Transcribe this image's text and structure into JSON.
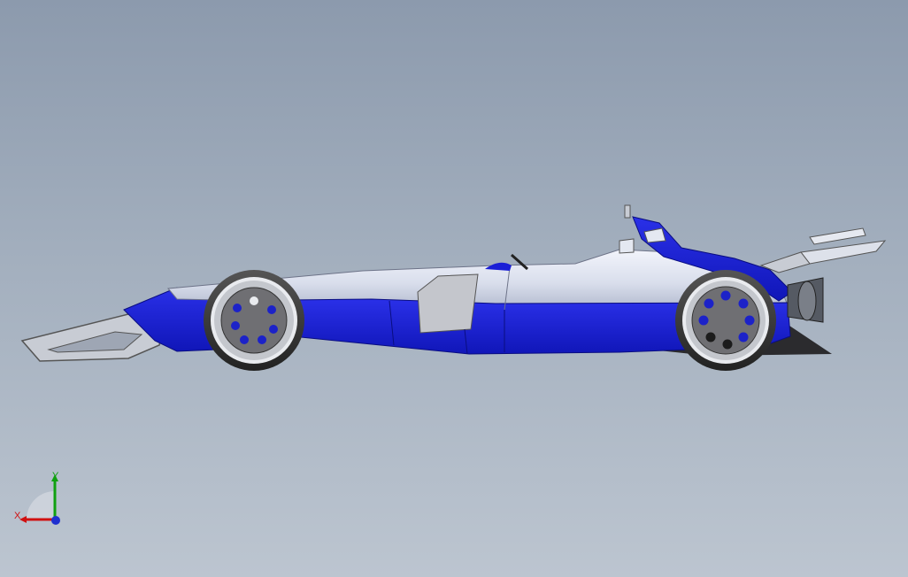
{
  "scene": {
    "name": "formula-car-model",
    "colors": {
      "background_top": "#8c9aad",
      "background_bottom": "#bcc5d0",
      "body_white": "#dde3f0",
      "body_blue": "#1a1fd6",
      "tire": "#3a3a3a",
      "wheel_rim": "#6f6f73",
      "wheel_holes": "#1c22c8"
    }
  },
  "triad": {
    "x_label": "X",
    "y_label": "Y",
    "x_color": "#d01010",
    "y_color": "#10a010",
    "z_color": "#2030d0"
  }
}
